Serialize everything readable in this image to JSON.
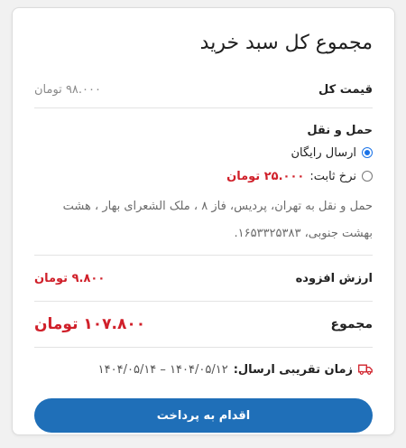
{
  "cart": {
    "title": "مجموع کل سبد خرید",
    "subtotal_label": "قیمت کل",
    "subtotal_value": "۹۸.۰۰۰ تومان",
    "shipping": {
      "title": "حمل و نقل",
      "option_free": "ارسال رایگان",
      "option_flat_label": "نرخ ثابت:",
      "option_flat_value": "۲۵.۰۰۰ تومان",
      "selected": "free",
      "address_text": "حمل و نقل به تهران، پردیس، فاز ۸ ، ملک الشعرای بهار ، هشت بهشت جنوبی، ۱۶۵۳۳۲۵۳۸۳."
    },
    "vat_label": "ارزش افزوده",
    "vat_value": "۹.۸۰۰ تومان",
    "total_label": "مجموع",
    "total_value": "۱۰۷.۸۰۰ تومان",
    "delivery_label": "زمان تقریبی ارسال:",
    "delivery_value": "۱۴۰۴/۰۵/۱۲ – ۱۴۰۴/۰۵/۱۴",
    "checkout_button": "اقدام به پرداخت"
  },
  "colors": {
    "accent": "#1f6fb8",
    "price_red": "#d0202a",
    "radio_blue": "#1a73e8",
    "truck_icon": "#d0202a"
  },
  "icons": {
    "delivery": "truck-icon"
  }
}
